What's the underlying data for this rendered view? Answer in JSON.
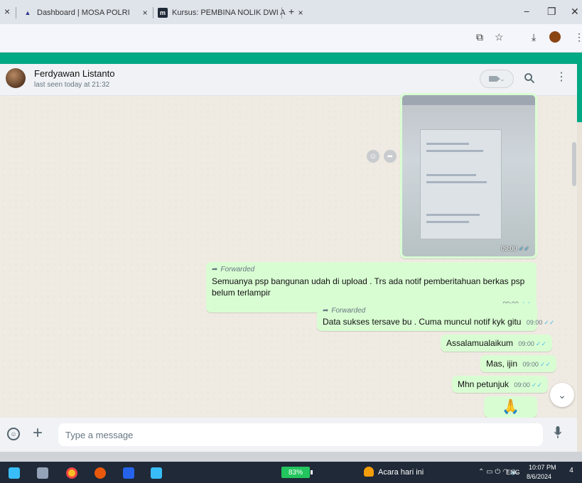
{
  "browser": {
    "tabs": [
      {
        "title": "Dashboard | MOSA POLRI",
        "icon": "mosa-logo-icon"
      },
      {
        "title": "Kursus: PEMBINA NOLIK DWI A",
        "icon": "moodle-icon"
      }
    ],
    "new_tab": "+",
    "tab_close": "×",
    "window_controls": {
      "minimize": "−",
      "maximize": "❐",
      "close": "✕"
    },
    "toolbar_icons": [
      "cast-icon",
      "bookmark-star-icon",
      "download-icon",
      "profile-icon",
      "more-icon"
    ]
  },
  "chat": {
    "contact_name": "Ferdyawan Listanto",
    "contact_status": "last seen today at 21:32",
    "image_message": {
      "time": "09:00"
    },
    "messages": [
      {
        "forwarded_label": "Forwarded",
        "text": "Semuanya psp bangunan udah di upload . Trs ada notif pemberitahuan berkas psp belum terlampir",
        "time": "09:00"
      },
      {
        "forwarded_label": "Forwarded",
        "text": "Data sukses tersave bu . Cuma muncul notif kyk gitu",
        "time": "09:00"
      },
      {
        "text": "Assalamualaikum",
        "time": "09:00"
      },
      {
        "text": "Mas, ijin",
        "time": "09:00"
      },
      {
        "text": "Mhn petunjuk",
        "time": "09:00"
      },
      {
        "text": "🙏"
      }
    ]
  },
  "compose": {
    "placeholder": "Type a message"
  },
  "taskbar": {
    "battery": "83%",
    "weather": "Acara hari ini",
    "language": "ENG",
    "time": "10:07 PM",
    "date": "8/6/2024",
    "notification_count": "4"
  },
  "colors": {
    "accent": "#00a884",
    "outgoing_bubble": "#d9fdd3",
    "read_ticks": "#53bdeb"
  }
}
